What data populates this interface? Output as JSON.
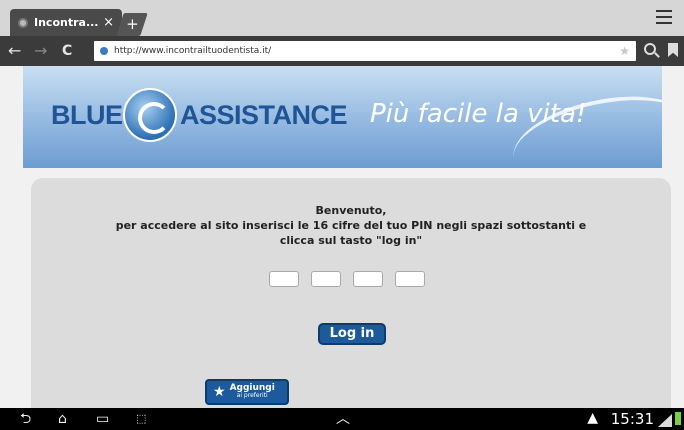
{
  "browser": {
    "tab_title": "Incontra...",
    "tab_close": "×",
    "new_tab": "+",
    "url": "http://www.incontrailtuodentista.it/"
  },
  "banner": {
    "brand_left": "BLUE",
    "brand_right": "ASSISTANCE",
    "tagline": "Più facile la vita!"
  },
  "form": {
    "welcome_line1": "Benvenuto,",
    "welcome_line2": "per accedere al sito inserisci le 16 cifre del tuo PIN negli spazi sottostanti e",
    "welcome_line3": "clicca sul tasto \"log in\"",
    "pin_fields": [
      "",
      "",
      "",
      ""
    ],
    "login_label": "Log in"
  },
  "favorites": {
    "label_main": "Aggiungi",
    "label_sub": "ai preferiti"
  },
  "status_bar": {
    "time": "15:31"
  },
  "colors": {
    "brand_blue": "#1f5596",
    "button_blue": "#1c5a9c",
    "battery_green": "#7bd13b"
  }
}
